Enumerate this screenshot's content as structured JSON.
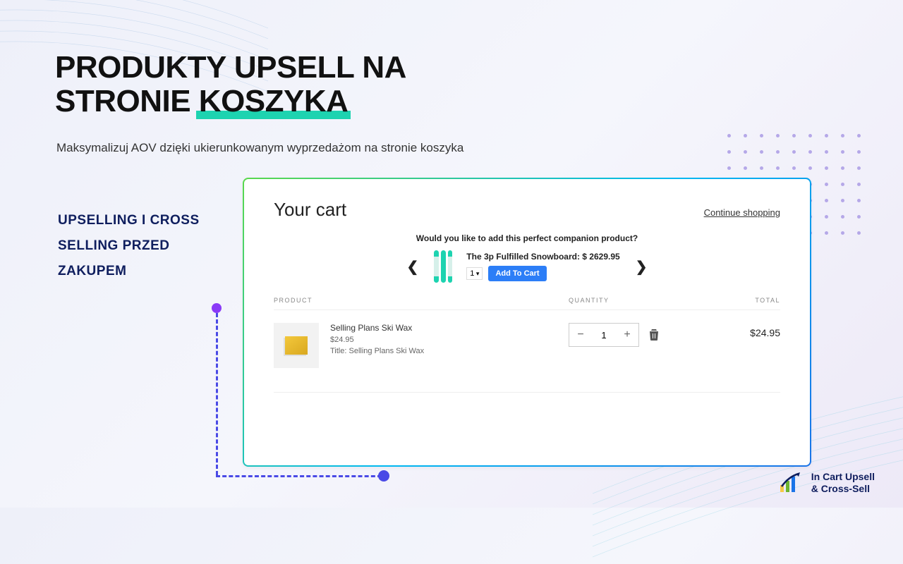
{
  "hero": {
    "title_line1": "PRODUKTY UPSELL NA",
    "title_line2_prefix": "STRONIE ",
    "title_line2_highlight": "KOSZYKA",
    "subtitle": "Maksymalizuj AOV dzięki ukierunkowanym wyprzedażom na stronie koszyka"
  },
  "side_label": {
    "line1": "UPSELLING I CROSS",
    "line2": "SELLING PRZED",
    "line3": "ZAKUPEM"
  },
  "cart": {
    "title": "Your cart",
    "continue_label": "Continue shopping",
    "upsell": {
      "prompt": "Would you like to add this perfect companion product?",
      "name": "The 3p Fulfilled Snowboard: $ 2629.95",
      "qty": "1",
      "add_label": "Add To Cart"
    },
    "columns": {
      "product": "PRODUCT",
      "quantity": "QUANTITY",
      "total": "TOTAL"
    },
    "item": {
      "name": "Selling Plans Ski Wax",
      "price": "$24.95",
      "variant": "Title: Selling Plans Ski Wax",
      "qty": "1",
      "total": "$24.95"
    }
  },
  "brand": {
    "line1": "In Cart Upsell",
    "line2": "& Cross-Sell"
  }
}
